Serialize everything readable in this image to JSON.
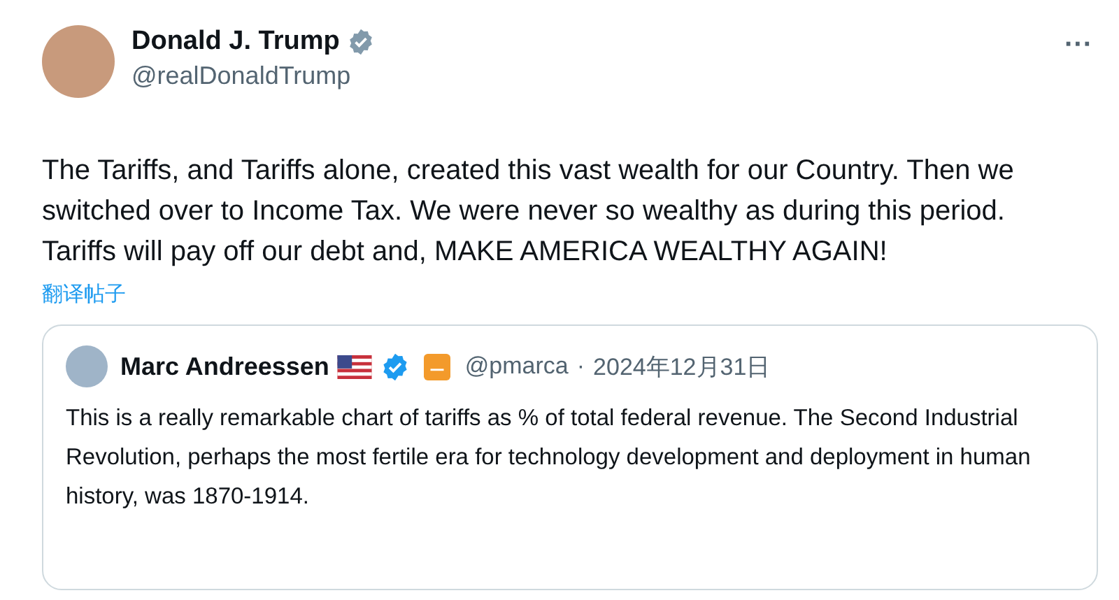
{
  "post": {
    "author": {
      "name": "Donald J. Trump",
      "handle": "@realDonaldTrump"
    },
    "more": "···",
    "text": "The Tariffs, and Tariffs alone, created this vast wealth for our Country. Then we switched over to Income Tax. We were never so wealthy as during this period. Tariffs will pay off our debt and, MAKE AMERICA WEALTHY AGAIN!",
    "translate_link": "翻译帖子",
    "quote": {
      "author": {
        "name": "Marc Andreessen",
        "handle": "@pmarca",
        "separator": "·",
        "date": "2024年12月31日"
      },
      "text": "This is a really remarkable chart of tariffs as % of total federal revenue. The Second Industrial Revolution, perhaps the most fertile era for technology development and deployment in human history, was 1870-1914."
    }
  }
}
